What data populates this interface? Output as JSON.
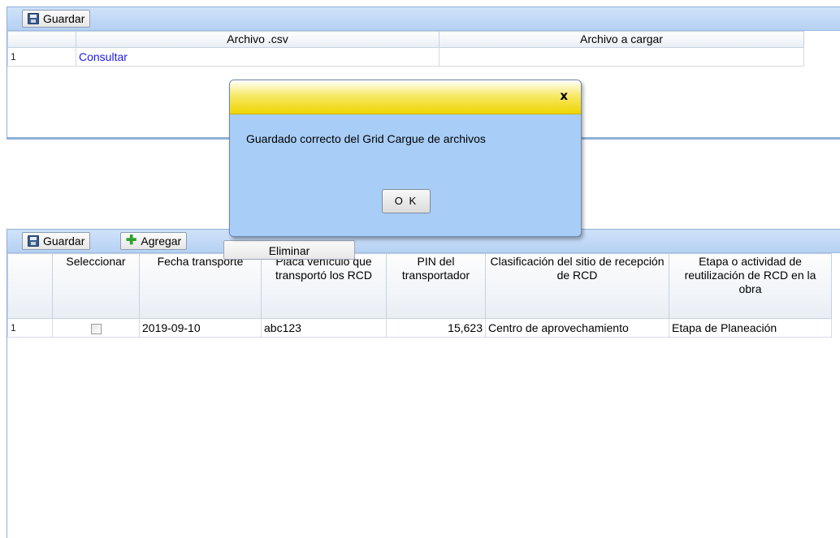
{
  "top_panel": {
    "save_label": "Guardar",
    "columns": [
      "",
      "Archivo .csv",
      "Archivo a cargar"
    ],
    "rows": [
      {
        "num": "1",
        "file": "Consultar",
        "upload": ""
      }
    ]
  },
  "bottom_panel": {
    "save_label": "Guardar",
    "add_label": "Agregar",
    "delete_label": "Eliminar",
    "columns": [
      "",
      "Seleccionar",
      "Fecha transporte",
      "Placa vehículo que transportó los RCD",
      "PIN del transportador",
      "Clasificación del sitio de recepción de RCD",
      "Etapa o actividad de reutilización de RCD en la obra"
    ],
    "rows": [
      {
        "num": "1",
        "checked": false,
        "fecha": "2019-09-10",
        "placa": "abc123",
        "pin": "15,623",
        "clasificacion": "Centro de aprovechamiento",
        "etapa": "Etapa de Planeación"
      }
    ]
  },
  "dialog": {
    "close": "x",
    "message": "Guardado correcto del Grid Cargue de archivos",
    "ok_label": "O K"
  }
}
